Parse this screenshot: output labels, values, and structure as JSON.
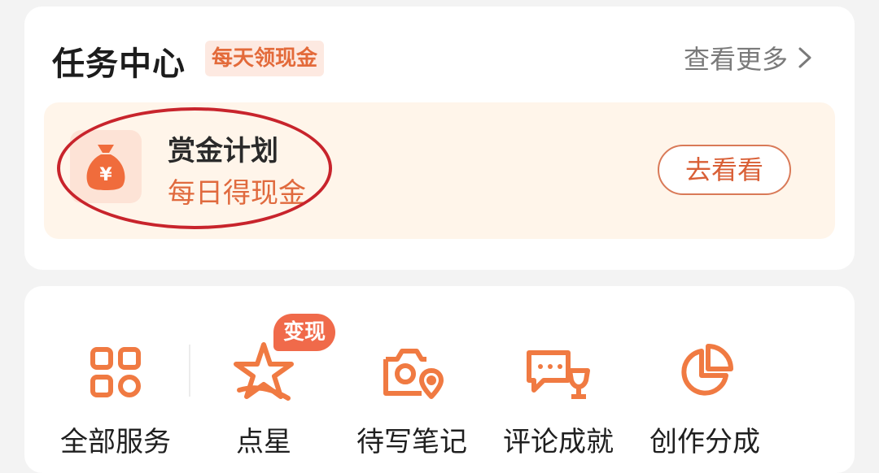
{
  "header": {
    "title": "任务中心",
    "tag": "每天领现金",
    "more_label": "查看更多"
  },
  "banner": {
    "icon": "money-bag-icon",
    "icon_glyph": "¥",
    "title": "赏金计划",
    "subtitle": "每日得现金",
    "button_label": "去看看"
  },
  "services": [
    {
      "label": "全部服务",
      "icon": "grid-icon"
    },
    {
      "label": "点星",
      "icon": "star-icon",
      "badge": "变现"
    },
    {
      "label": "待写笔记",
      "icon": "camera-location-icon"
    },
    {
      "label": "评论成就",
      "icon": "comment-trophy-icon"
    },
    {
      "label": "创作分成",
      "icon": "pie-chart-icon"
    }
  ],
  "colors": {
    "accent": "#e36a3a",
    "circle_highlight": "#c8242c",
    "banner_bg": "#fff5ea"
  }
}
